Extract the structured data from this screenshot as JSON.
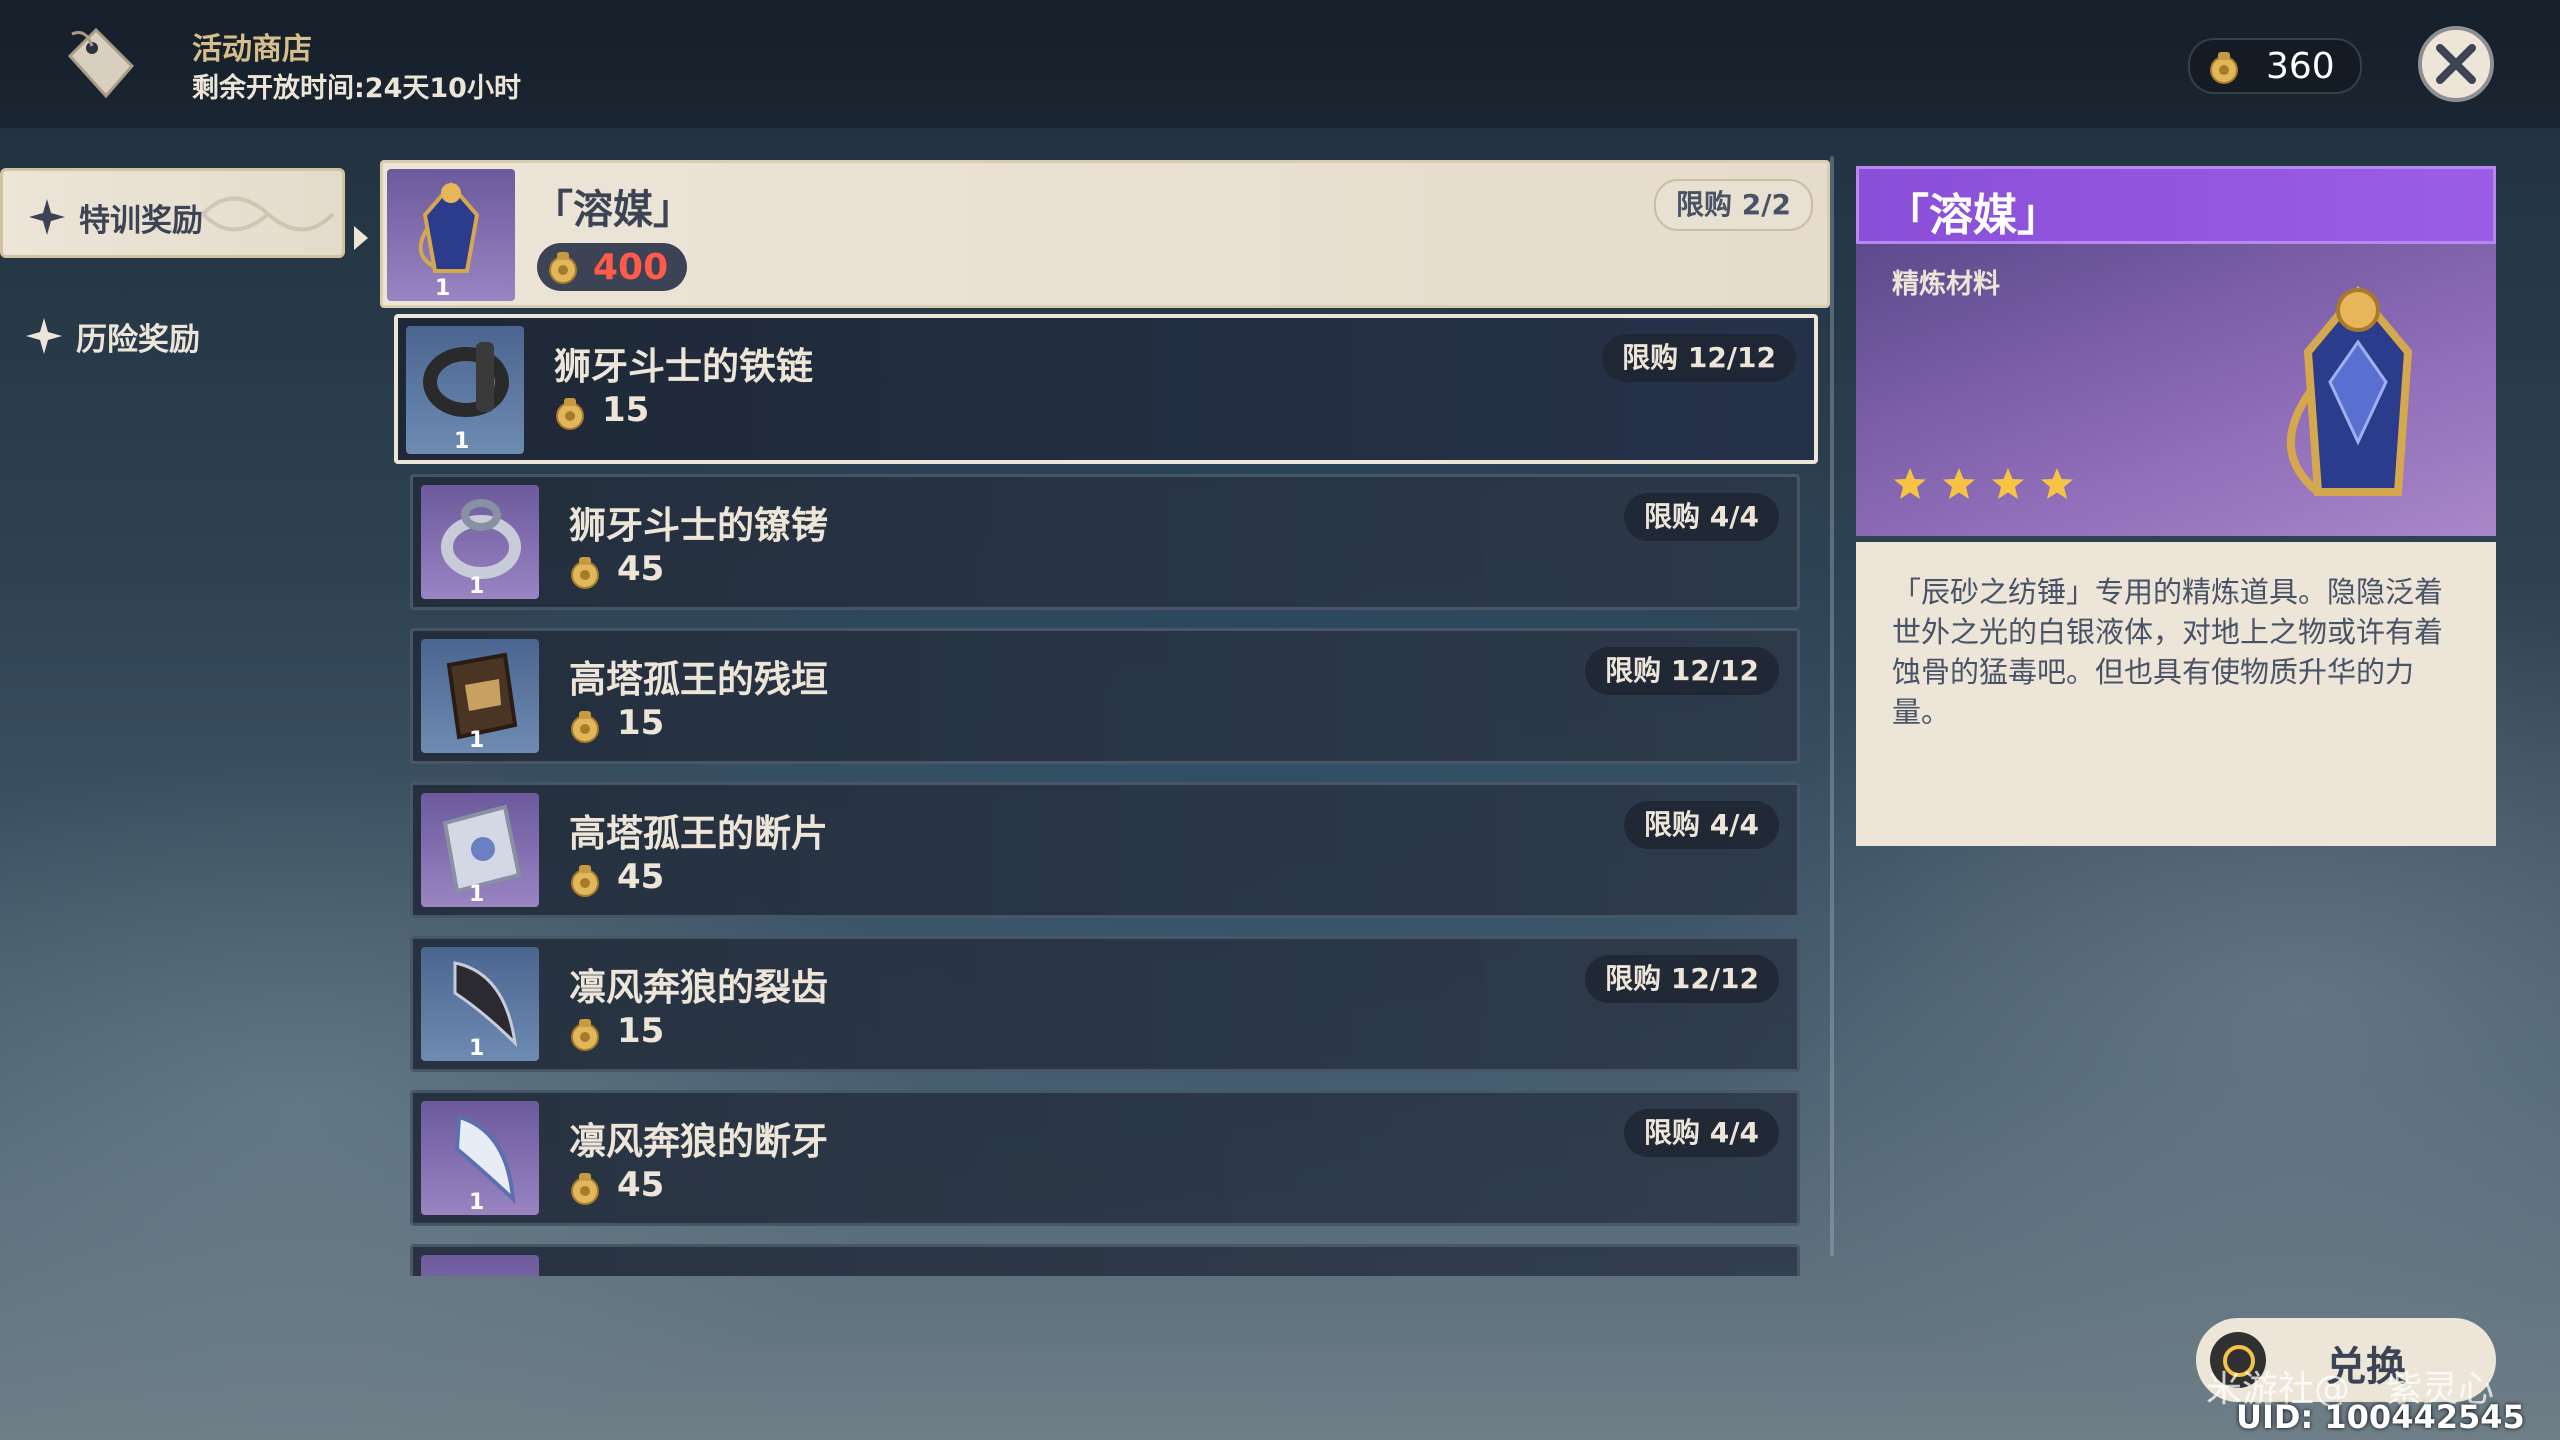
{
  "header": {
    "shop_title": "活动商店",
    "remaining_time": "剩余开放时间:24天10小时",
    "currency_amount": "360"
  },
  "sidebar": {
    "items": [
      {
        "label": "特训奖励",
        "active": true
      },
      {
        "label": "历险奖励",
        "active": false
      }
    ]
  },
  "shop_list": [
    {
      "name": "「溶媒」",
      "price": "400",
      "limit": "限购 2/2",
      "quantity": "1",
      "icon": "solvent-icon",
      "state": "featured"
    },
    {
      "name": "狮牙斗士的铁链",
      "price": "15",
      "limit": "限购 12/12",
      "quantity": "1",
      "icon": "iron-chain-icon",
      "state": "selected"
    },
    {
      "name": "狮牙斗士的镣铐",
      "price": "45",
      "limit": "限购 4/4",
      "quantity": "1",
      "icon": "shackles-icon",
      "state": "normal"
    },
    {
      "name": "高塔孤王的残垣",
      "price": "15",
      "limit": "限购 12/12",
      "quantity": "1",
      "icon": "ruin-icon",
      "state": "normal"
    },
    {
      "name": "高塔孤王的断片",
      "price": "45",
      "limit": "限购 4/4",
      "quantity": "1",
      "icon": "fragment-icon",
      "state": "normal"
    },
    {
      "name": "凛风奔狼的裂齿",
      "price": "15",
      "limit": "限购 12/12",
      "quantity": "1",
      "icon": "cracked-tooth-icon",
      "state": "normal"
    },
    {
      "name": "凛风奔狼的断牙",
      "price": "45",
      "limit": "限购 4/4",
      "quantity": "1",
      "icon": "broken-fang-icon",
      "state": "normal"
    }
  ],
  "detail": {
    "title": "「溶媒」",
    "type": "精炼材料",
    "stars": 4,
    "description": "「辰砂之纺锤」专用的精炼道具。隐隐泛着世外之光的白银液体，对地上之物或许有着蚀骨的猛毒吧。但也具有使物质升华的力量。"
  },
  "footer": {
    "exchange_label": "兑换",
    "uid": "UID: 100442545",
    "watermark": "米游社@　紫灵心"
  },
  "colors": {
    "accent_purple": "#9b5de5",
    "price_red": "#ff5a4a",
    "cream": "#ece5d8"
  }
}
